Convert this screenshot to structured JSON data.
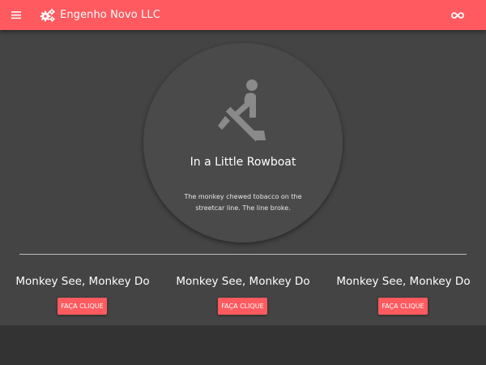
{
  "header": {
    "menu_icon": "menu-icon",
    "brand_icon": "gears-icon",
    "title": "Engenho Novo LLC",
    "action_icon": "infinity-icon",
    "color": "#ff5a5f"
  },
  "hero": {
    "icon": "rowing-icon",
    "title": "In a Little Rowboat",
    "text": "The monkey chewed tobacco on the streetcar line. The line broke."
  },
  "columns": [
    {
      "title": "Monkey See, Monkey Do",
      "button_label": "FAÇA CLIQUE"
    },
    {
      "title": "Monkey See, Monkey Do",
      "button_label": "FAÇA CLIQUE"
    },
    {
      "title": "Monkey See, Monkey Do",
      "button_label": "FAÇA CLIQUE"
    }
  ],
  "colors": {
    "accent": "#ff5a5f",
    "background": "#444444",
    "circle": "#4a4a4a",
    "footer": "#333333"
  }
}
